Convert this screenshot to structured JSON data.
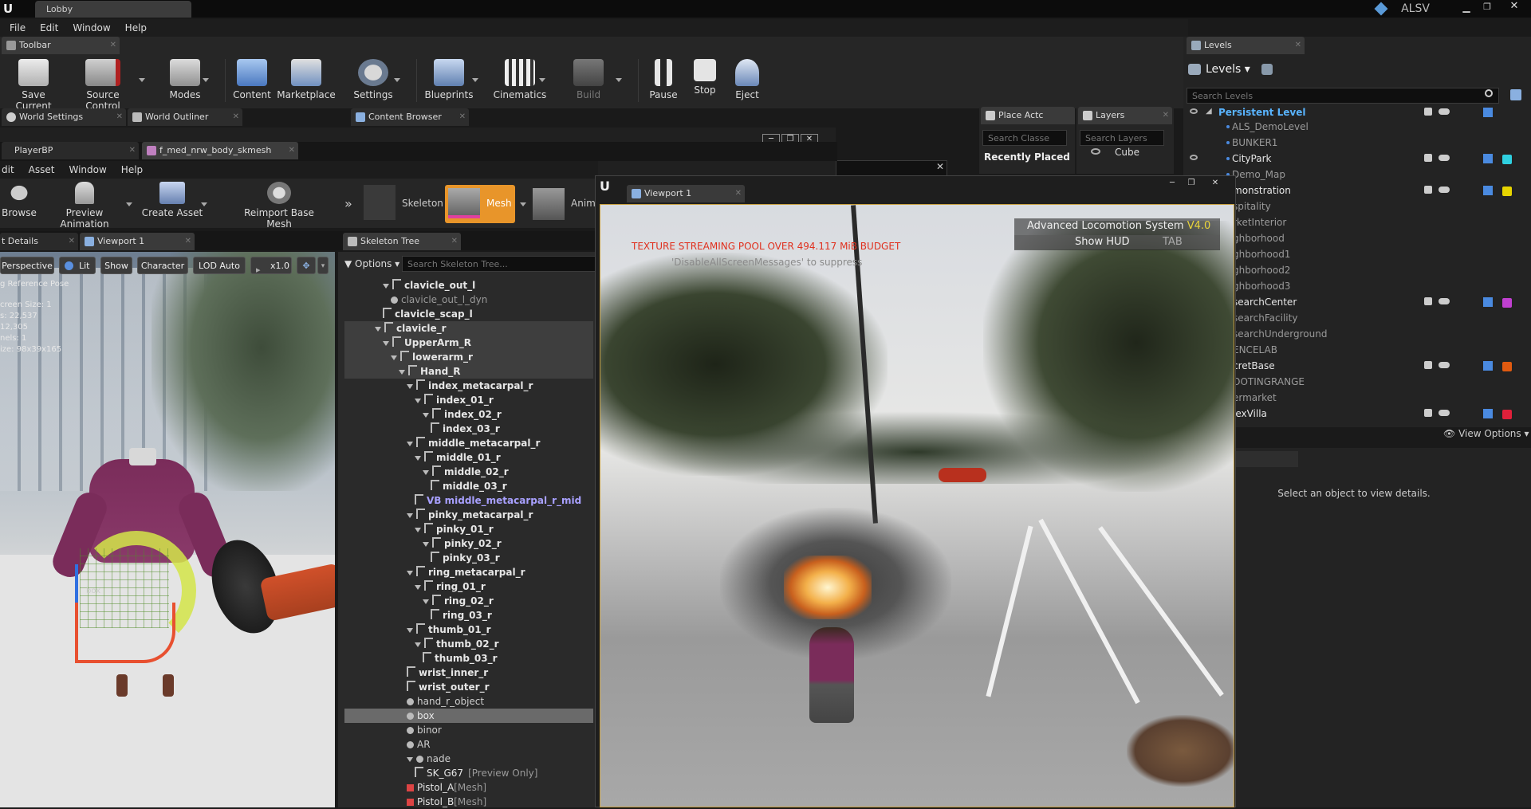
{
  "title_bar": {
    "tab": "Lobby",
    "right_label": "ALSV"
  },
  "main_menu": [
    "File",
    "Edit",
    "Window",
    "Help"
  ],
  "toolbar_tab": "Toolbar",
  "toolbar": [
    {
      "label": "Save Current",
      "icon": "save-icon"
    },
    {
      "label": "Source Control",
      "icon": "source-control-icon"
    },
    {
      "label": "Modes",
      "icon": "modes-icon"
    },
    {
      "label": "Content",
      "icon": "content-icon"
    },
    {
      "label": "Marketplace",
      "icon": "marketplace-icon"
    },
    {
      "label": "Settings",
      "icon": "settings-icon"
    },
    {
      "label": "Blueprints",
      "icon": "blueprints-icon"
    },
    {
      "label": "Cinematics",
      "icon": "cinematics-icon"
    },
    {
      "label": "Build",
      "icon": "build-icon"
    },
    {
      "label": "Pause",
      "icon": "pause-icon"
    },
    {
      "label": "Stop",
      "icon": "stop-icon"
    },
    {
      "label": "Eject",
      "icon": "eject-icon"
    }
  ],
  "panel_tabs": {
    "world_settings": "World Settings",
    "world_outliner": "World Outliner",
    "content_browser": "Content Browser",
    "place_actors": "Place Actc",
    "layers": "Layers",
    "levels": "Levels"
  },
  "editor_tabs": {
    "player_bp": "PlayerBP",
    "mesh_asset": "f_med_nrw_body_skmesh"
  },
  "editor_menu": [
    "dit",
    "Asset",
    "Window",
    "Help"
  ],
  "editor_toolbar": {
    "browse": "Browse",
    "preview_animation": "Preview Animation",
    "create_asset": "Create Asset",
    "reimport": "Reimport Base Mesh",
    "skeleton": "Skeleton",
    "mesh": "Mesh",
    "anim": "Anim"
  },
  "details_tabs": {
    "details": "t Details",
    "viewport": "Viewport 1"
  },
  "viewport_bar": {
    "perspective": "Perspective",
    "lit": "Lit",
    "show": "Show",
    "character": "Character",
    "lod": "LOD Auto",
    "speed": "x1.0"
  },
  "viewport_stats": [
    "g Reference Pose",
    "creen Size: 1",
    "s: 22,537",
    "12,305",
    "nels: 1",
    "ize: 98x39x165"
  ],
  "viewport_label": "box",
  "skeleton_tree": {
    "tab": "Skeleton Tree",
    "options": "Options",
    "search_placeholder": "Search Skeleton Tree...",
    "rows": [
      {
        "name": "clavicle_out_l",
        "indent": 4,
        "bold": true,
        "arrow": true
      },
      {
        "name": "clavicle_out_l_dyn",
        "indent": 5,
        "bold": false,
        "socket": true
      },
      {
        "name": "clavicle_scap_l",
        "indent": 4,
        "bold": true
      },
      {
        "name": "clavicle_r",
        "indent": 3,
        "bold": true,
        "arrow": true,
        "sel": true
      },
      {
        "name": "UpperArm_R",
        "indent": 4,
        "bold": true,
        "arrow": true,
        "sel": true
      },
      {
        "name": "lowerarm_r",
        "indent": 5,
        "bold": true,
        "arrow": true,
        "sel": true
      },
      {
        "name": "Hand_R",
        "indent": 6,
        "bold": true,
        "arrow": true,
        "sel": true
      },
      {
        "name": "index_metacarpal_r",
        "indent": 7,
        "bold": true,
        "arrow": true
      },
      {
        "name": "index_01_r",
        "indent": 8,
        "bold": true,
        "arrow": true
      },
      {
        "name": "index_02_r",
        "indent": 9,
        "bold": true,
        "arrow": true
      },
      {
        "name": "index_03_r",
        "indent": 10,
        "bold": true
      },
      {
        "name": "middle_metacarpal_r",
        "indent": 7,
        "bold": true,
        "arrow": true
      },
      {
        "name": "middle_01_r",
        "indent": 8,
        "bold": true,
        "arrow": true
      },
      {
        "name": "middle_02_r",
        "indent": 9,
        "bold": true,
        "arrow": true
      },
      {
        "name": "middle_03_r",
        "indent": 10,
        "bold": true
      },
      {
        "name": "VB middle_metacarpal_r_mid",
        "indent": 8,
        "bold": true,
        "vb": true
      },
      {
        "name": "pinky_metacarpal_r",
        "indent": 7,
        "bold": true,
        "arrow": true
      },
      {
        "name": "pinky_01_r",
        "indent": 8,
        "bold": true,
        "arrow": true
      },
      {
        "name": "pinky_02_r",
        "indent": 9,
        "bold": true,
        "arrow": true
      },
      {
        "name": "pinky_03_r",
        "indent": 10,
        "bold": true
      },
      {
        "name": "ring_metacarpal_r",
        "indent": 7,
        "bold": true,
        "arrow": true
      },
      {
        "name": "ring_01_r",
        "indent": 8,
        "bold": true,
        "arrow": true
      },
      {
        "name": "ring_02_r",
        "indent": 9,
        "bold": true,
        "arrow": true
      },
      {
        "name": "ring_03_r",
        "indent": 10,
        "bold": true
      },
      {
        "name": "thumb_01_r",
        "indent": 7,
        "bold": true,
        "arrow": true
      },
      {
        "name": "thumb_02_r",
        "indent": 8,
        "bold": true,
        "arrow": true
      },
      {
        "name": "thumb_03_r",
        "indent": 9,
        "bold": true
      },
      {
        "name": "wrist_inner_r",
        "indent": 7,
        "bold": true
      },
      {
        "name": "wrist_outer_r",
        "indent": 7,
        "bold": true
      },
      {
        "name": "hand_r_object",
        "indent": 7,
        "bold": false,
        "socket": true
      },
      {
        "name": "box",
        "indent": 7,
        "bold": false,
        "socket": true,
        "selected": true
      },
      {
        "name": "binor",
        "indent": 7,
        "bold": false,
        "socket": true
      },
      {
        "name": "AR",
        "indent": 7,
        "bold": false,
        "socket": true
      },
      {
        "name": "nade",
        "indent": 7,
        "bold": false,
        "socket": true,
        "arrow": true
      },
      {
        "name": "SK_G67",
        "suffix": "[Preview Only]",
        "indent": 8,
        "bold": false
      },
      {
        "name": "Pistol_A",
        "suffix": "[Mesh]",
        "indent": 7,
        "bold": false,
        "red": true
      },
      {
        "name": "Pistol_B",
        "suffix": "[Mesh]",
        "indent": 7,
        "bold": false,
        "red": true
      }
    ]
  },
  "place_actors": {
    "search_placeholder": "Search Classe",
    "recent": "Recently Placed"
  },
  "layers": {
    "search_placeholder": "Search Layers",
    "item": "Cube"
  },
  "levels": {
    "title": "Levels",
    "search_placeholder": "Search Levels",
    "persistent": "Persistent Level",
    "items": [
      "ALS_DemoLevel",
      "BUNKER1",
      "CityPark",
      "Demo_Map",
      "monstration",
      "spitality",
      "rketInterior",
      "ghborhood",
      "ghborhood1",
      "ghborhood2",
      "ghborhood3",
      "searchCenter",
      "searchFacility",
      "searchUnderground",
      "ENCELAB",
      "cretBase",
      "OOTINGRANGE",
      "ermarket",
      "lexVilla"
    ],
    "view_options": "View Options",
    "select_hint": "Select an object to view details."
  },
  "game_viewport": {
    "tab": "Viewport 1",
    "warning": "TEXTURE STREAMING POOL OVER 494.117 MiB BUDGET",
    "suppress": "'DisableAllScreenMessages' to suppress",
    "als_title": "Advanced Locomotion System",
    "als_version": "V4.0",
    "show_hud": "Show HUD",
    "tab_key": "TAB"
  },
  "colors": {
    "accent_blue": "#2c78d8",
    "level_cyan": "#2fd0e0",
    "level_yellow": "#e6d400",
    "level_magenta": "#c040d0",
    "level_orange": "#e05a10",
    "level_red": "#e0203a",
    "warning_red": "#e0301e",
    "als_yellow": "#e8d33b"
  }
}
